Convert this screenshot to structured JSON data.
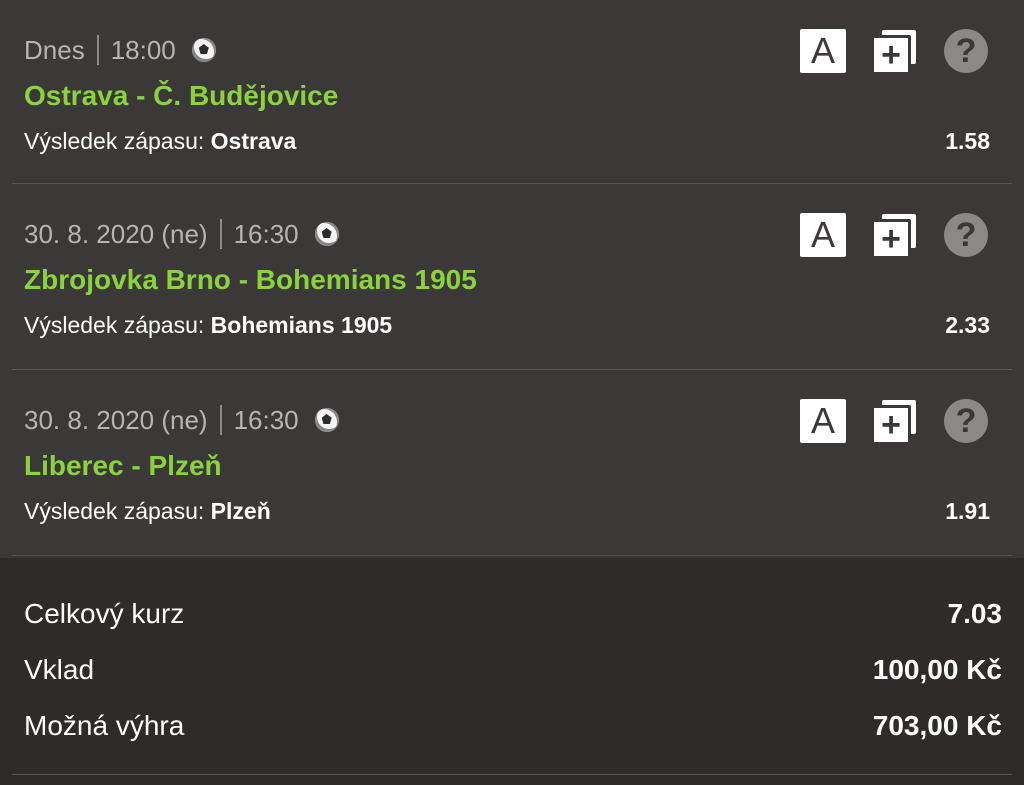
{
  "bets": [
    {
      "date": "Dnes",
      "time": "18:00",
      "match": "Ostrava - Č. Budějovice",
      "market_label": "Výsledek zápasu:",
      "selection": "Ostrava",
      "odds": "1.58",
      "sport_icon": "soccer-ball-icon"
    },
    {
      "date": "30. 8. 2020 (ne)",
      "time": "16:30",
      "match": "Zbrojovka Brno - Bohemians 1905",
      "market_label": "Výsledek zápasu:",
      "selection": "Bohemians 1905",
      "odds": "2.33",
      "sport_icon": "soccer-ball-icon"
    },
    {
      "date": "30. 8. 2020 (ne)",
      "time": "16:30",
      "match": "Liberec - Plzeň",
      "market_label": "Výsledek zápasu:",
      "selection": "Plzeň",
      "odds": "1.91",
      "sport_icon": "soccer-ball-icon"
    }
  ],
  "actions": {
    "a_label": "A",
    "copy_label": "+",
    "help_label": "?"
  },
  "summary": {
    "total_odds_label": "Celkový kurz",
    "total_odds_value": "7.03",
    "stake_label": "Vklad",
    "stake_value": "100,00 Kč",
    "win_label": "Možná výhra",
    "win_value": "703,00 Kč"
  },
  "colors": {
    "match_green": "#8bd23f",
    "background": "#3a3937",
    "summary_background": "#2d2c2a"
  }
}
